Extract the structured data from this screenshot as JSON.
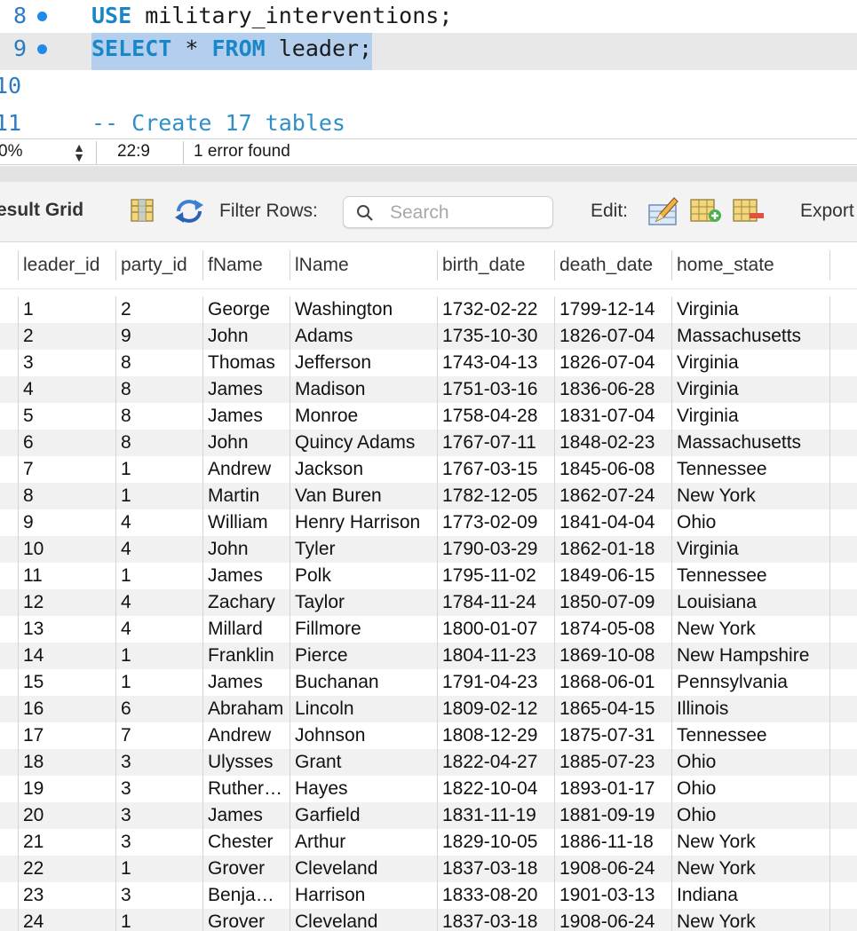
{
  "editor": {
    "lines": [
      {
        "num": "8",
        "keyword": "USE",
        "rest": " military_interventions;"
      },
      {
        "num": "9",
        "kw1": "SELECT",
        "star": " * ",
        "kw2": "FROM",
        "rest": " leader;"
      },
      {
        "num": "10"
      },
      {
        "num": "11",
        "comment": "-- Create 17 tables"
      }
    ]
  },
  "statusbar": {
    "zoom": "0%",
    "position": "22:9",
    "message": "1 error found"
  },
  "toolbar": {
    "title": "esult Grid",
    "filter_label": "Filter Rows:",
    "search_placeholder": "Search",
    "edit_label": "Edit:",
    "export_label": "Export"
  },
  "grid": {
    "columns": [
      "leader_id",
      "party_id",
      "fName",
      "lName",
      "birth_date",
      "death_date",
      "home_state"
    ],
    "rows": [
      [
        "1",
        "2",
        "George",
        "Washington",
        "1732-02-22",
        "1799-12-14",
        "Virginia"
      ],
      [
        "2",
        "9",
        "John",
        "Adams",
        "1735-10-30",
        "1826-07-04",
        "Massachusetts"
      ],
      [
        "3",
        "8",
        "Thomas",
        "Jefferson",
        "1743-04-13",
        "1826-07-04",
        "Virginia"
      ],
      [
        "4",
        "8",
        "James",
        "Madison",
        "1751-03-16",
        "1836-06-28",
        "Virginia"
      ],
      [
        "5",
        "8",
        "James",
        "Monroe",
        "1758-04-28",
        "1831-07-04",
        "Virginia"
      ],
      [
        "6",
        "8",
        "John",
        "Quincy Adams",
        "1767-07-11",
        "1848-02-23",
        "Massachusetts"
      ],
      [
        "7",
        "1",
        "Andrew",
        "Jackson",
        "1767-03-15",
        "1845-06-08",
        "Tennessee"
      ],
      [
        "8",
        "1",
        "Martin",
        "Van Buren",
        "1782-12-05",
        "1862-07-24",
        "New York"
      ],
      [
        "9",
        "4",
        "William",
        "Henry Harrison",
        "1773-02-09",
        "1841-04-04",
        "Ohio"
      ],
      [
        "10",
        "4",
        "John",
        "Tyler",
        "1790-03-29",
        "1862-01-18",
        "Virginia"
      ],
      [
        "11",
        "1",
        "James",
        "Polk",
        "1795-11-02",
        "1849-06-15",
        "Tennessee"
      ],
      [
        "12",
        "4",
        "Zachary",
        "Taylor",
        "1784-11-24",
        "1850-07-09",
        "Louisiana"
      ],
      [
        "13",
        "4",
        "Millard",
        "Fillmore",
        "1800-01-07",
        "1874-05-08",
        "New York"
      ],
      [
        "14",
        "1",
        "Franklin",
        "Pierce",
        "1804-11-23",
        "1869-10-08",
        "New Hampshire"
      ],
      [
        "15",
        "1",
        "James",
        "Buchanan",
        "1791-04-23",
        "1868-06-01",
        "Pennsylvania"
      ],
      [
        "16",
        "6",
        "Abraham",
        "Lincoln",
        "1809-02-12",
        "1865-04-15",
        "Illinois"
      ],
      [
        "17",
        "7",
        "Andrew",
        "Johnson",
        "1808-12-29",
        "1875-07-31",
        "Tennessee"
      ],
      [
        "18",
        "3",
        "Ulysses",
        "Grant",
        "1822-04-27",
        "1885-07-23",
        "Ohio"
      ],
      [
        "19",
        "3",
        "Ruther…",
        "Hayes",
        "1822-10-04",
        "1893-01-17",
        "Ohio"
      ],
      [
        "20",
        "3",
        "James",
        "Garfield",
        "1831-11-19",
        "1881-09-19",
        "Ohio"
      ],
      [
        "21",
        "3",
        "Chester",
        "Arthur",
        "1829-10-05",
        "1886-11-18",
        "New York"
      ],
      [
        "22",
        "1",
        "Grover",
        "Cleveland",
        "1837-03-18",
        "1908-06-24",
        "New York"
      ],
      [
        "23",
        "3",
        "Benja…",
        "Harrison",
        "1833-08-20",
        "1901-03-13",
        "Indiana"
      ],
      [
        "24",
        "1",
        "Grover",
        "Cleveland",
        "1837-03-18",
        "1908-06-24",
        "New York"
      ]
    ]
  }
}
